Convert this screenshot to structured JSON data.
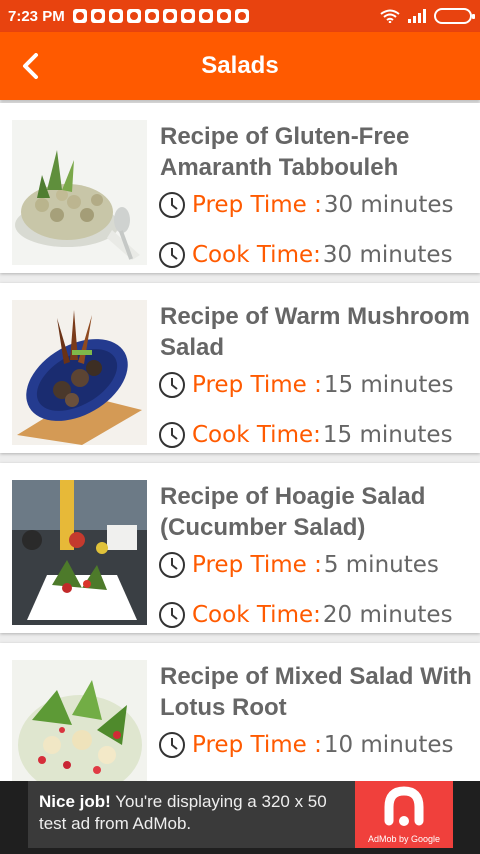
{
  "status_bar": {
    "time": "7:23 PM"
  },
  "app_bar": {
    "title": "Salads"
  },
  "recipes": [
    {
      "title": "Recipe of Gluten-Free Amaranth Tabbouleh",
      "prep_label": "Prep Time :",
      "prep_value": "30 minutes",
      "cook_label": "Cook Time:",
      "cook_value": "30 minutes"
    },
    {
      "title": "Recipe of Warm Mushroom Salad",
      "prep_label": "Prep Time :",
      "prep_value": "15 minutes",
      "cook_label": "Cook Time:",
      "cook_value": "15 minutes"
    },
    {
      "title": "Recipe of Hoagie Salad (Cucumber Salad)",
      "prep_label": "Prep Time :",
      "prep_value": "5 minutes",
      "cook_label": "Cook Time:",
      "cook_value": "20 minutes"
    },
    {
      "title": "Recipe of Mixed Salad With Lotus Root",
      "prep_label": "Prep Time :",
      "prep_value": "10 minutes"
    }
  ],
  "ad": {
    "headline": "Nice job!",
    "body": " You're displaying a 320 x 50 test ad from AdMob.",
    "logo_caption": "AdMob by Google"
  },
  "colors": {
    "status_bar": "#e8430f",
    "app_bar": "#ff5a00",
    "accent_text": "#ff5a00",
    "body_text": "#666666",
    "admob_red": "#f0403c"
  },
  "icons": [
    "back-arrow-icon",
    "clock-icon",
    "wifi-icon",
    "signal-icon",
    "battery-icon",
    "admob-icon"
  ]
}
